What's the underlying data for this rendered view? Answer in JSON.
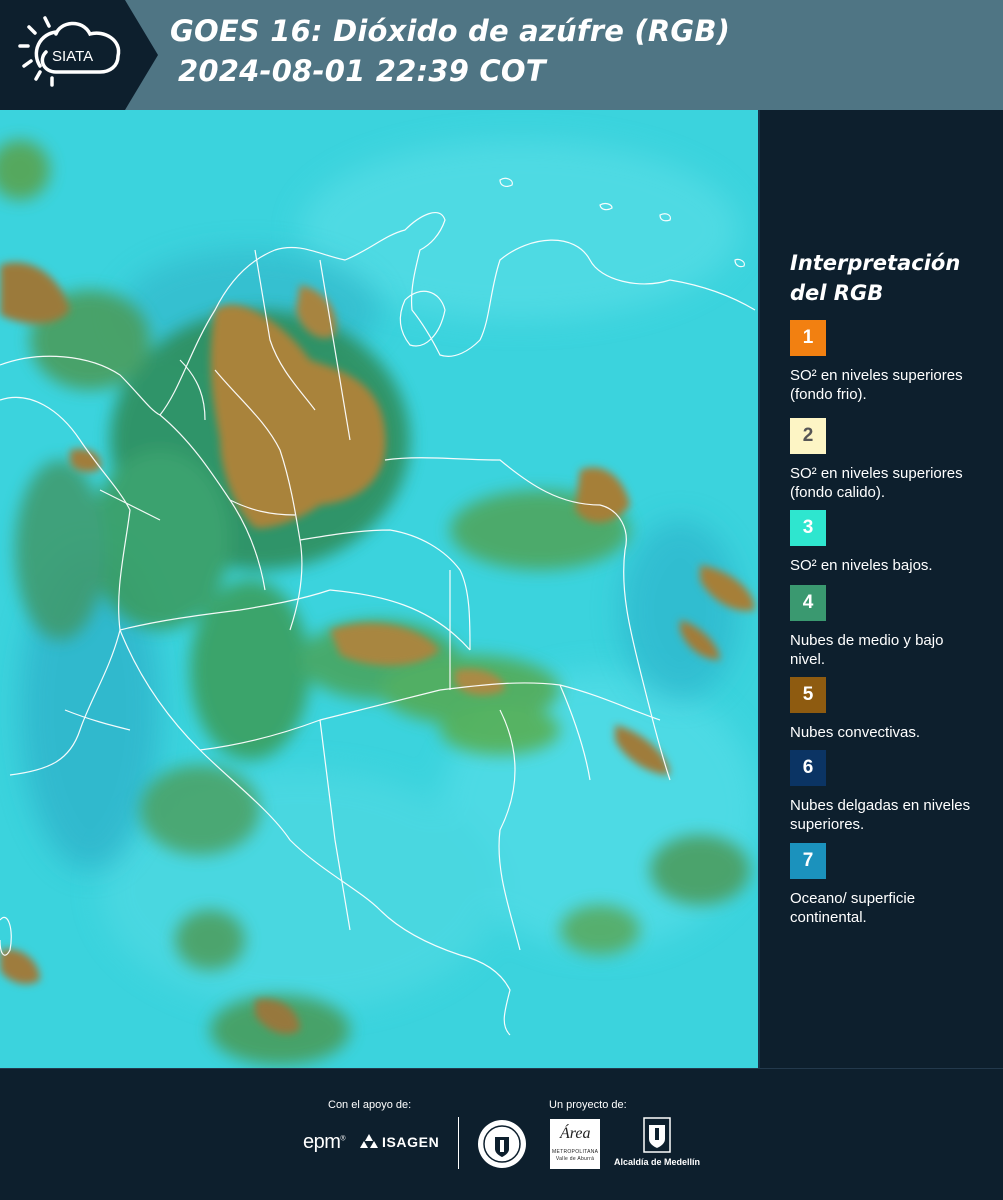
{
  "header": {
    "logo_text": "SIATA",
    "title_line1": "GOES 16: Dióxido de azúfre (RGB)",
    "title_line2": "2024-08-01 22:39 COT"
  },
  "map": {
    "description_icon": "satellite-rgb-map"
  },
  "legend": {
    "title_line1": "Interpretación",
    "title_line2": "del RGB",
    "items": [
      {
        "number": "1",
        "color": "#f28011",
        "number_color": "#ffffff",
        "text": "SO² en niveles superiores (fondo frio)."
      },
      {
        "number": "2",
        "color": "#fdf5c5",
        "number_color": "#555555",
        "text": "SO² en niveles superiores (fondo calido)."
      },
      {
        "number": "3",
        "color": "#2ee6cf",
        "number_color": "#ffffff",
        "text": "SO² en niveles bajos."
      },
      {
        "number": "4",
        "color": "#3a9970",
        "number_color": "#ffffff",
        "text": "Nubes de medio y bajo nivel."
      },
      {
        "number": "5",
        "color": "#8e5b10",
        "number_color": "#ffffff",
        "text": "Nubes convectivas."
      },
      {
        "number": "6",
        "color": "#0b3464",
        "number_color": "#ffffff",
        "text": "Nubes delgadas en niveles superiores."
      },
      {
        "number": "7",
        "color": "#1b92bd",
        "number_color": "#ffffff",
        "text": "Oceano/ superficie continental."
      }
    ]
  },
  "footer": {
    "support_label": "Con el apoyo de:",
    "project_label": "Un proyecto de:",
    "epm": "epm",
    "isagen": "ISAGEN",
    "area_word": "Área",
    "area_sub": "METROPOLITANA Valle de Aburrá",
    "alcaldia": "Alcaldía de Medellín"
  }
}
